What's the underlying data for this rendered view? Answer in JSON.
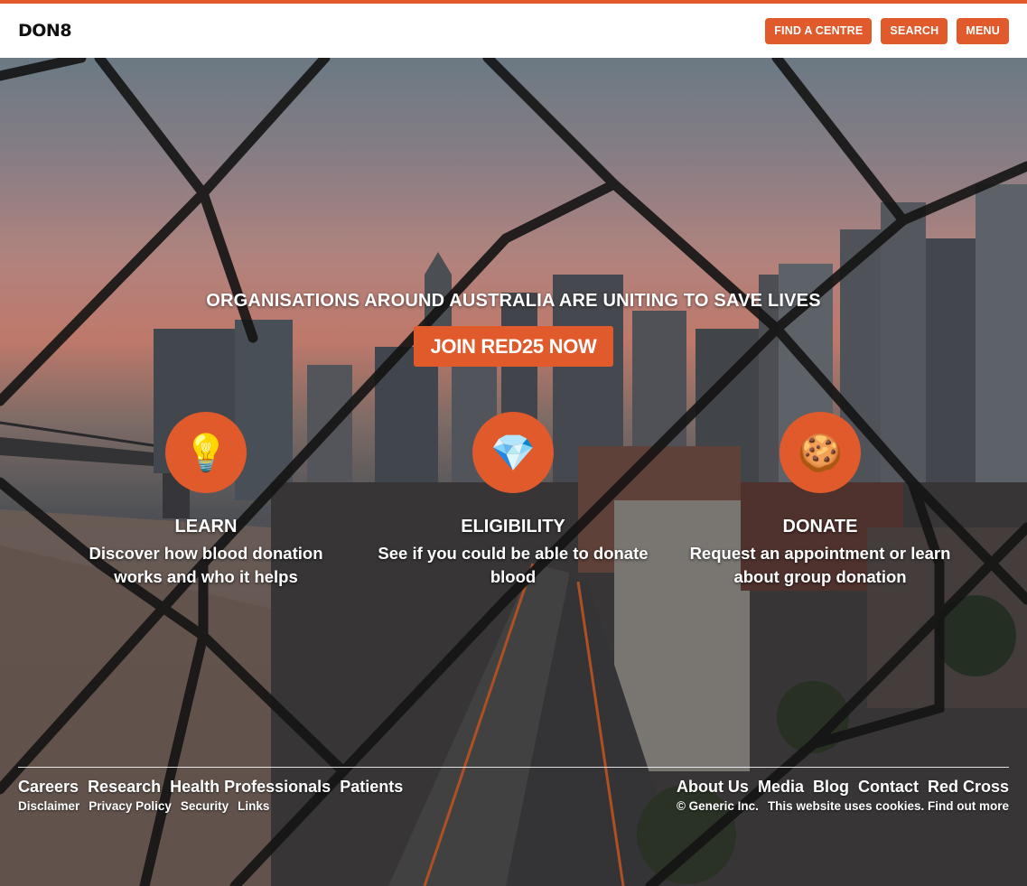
{
  "header": {
    "logo": "DON8",
    "buttons": {
      "find_centre": "FIND A CENTRE",
      "search": "SEARCH",
      "menu": "MENU"
    }
  },
  "hero": {
    "tagline": "ORGANISATIONS AROUND AUSTRALIA ARE UNITING TO SAVE LIVES",
    "cta": "JOIN RED25 NOW"
  },
  "features": [
    {
      "icon": "lightbulb-icon",
      "glyph": "💡",
      "title": "LEARN",
      "desc": "Discover how blood donation works and who it helps"
    },
    {
      "icon": "gem-icon",
      "glyph": "💎",
      "title": "ELIGIBILITY",
      "desc": "See if you could be able to donate blood"
    },
    {
      "icon": "cookie-icon",
      "glyph": "🍪",
      "title": "DONATE",
      "desc": "Request an appointment or learn about group donation"
    }
  ],
  "footer": {
    "main_links": [
      "Careers",
      "Research",
      "Health Professionals",
      "Patients"
    ],
    "sub_links": [
      "Disclaimer",
      "Privacy Policy",
      "Security",
      "Links"
    ],
    "right_links": [
      "About Us",
      "Media",
      "Blog",
      "Contact",
      "Red Cross"
    ],
    "copyright": "© Generic Inc.",
    "cookie_notice": "This website uses cookies. Find out more"
  },
  "colors": {
    "accent": "#e05a2b",
    "header_bg": "#ffffff",
    "text_on_hero": "#ffffff"
  }
}
